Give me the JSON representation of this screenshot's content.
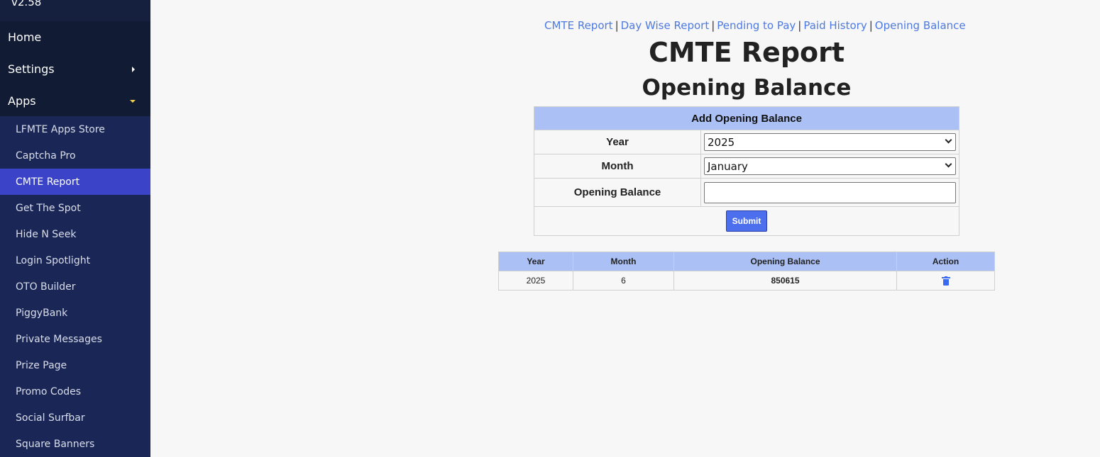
{
  "sidebar": {
    "version": "v2.58",
    "top_items": [
      {
        "label": "Home"
      },
      {
        "label": "Settings"
      },
      {
        "label": "Apps"
      }
    ],
    "app_items": [
      {
        "label": "LFMTE Apps Store"
      },
      {
        "label": "Captcha Pro"
      },
      {
        "label": "CMTE Report",
        "active": true
      },
      {
        "label": "Get The Spot"
      },
      {
        "label": "Hide N Seek"
      },
      {
        "label": "Login Spotlight"
      },
      {
        "label": "OTO Builder"
      },
      {
        "label": "PiggyBank"
      },
      {
        "label": "Private Messages"
      },
      {
        "label": "Prize Page"
      },
      {
        "label": "Promo Codes"
      },
      {
        "label": "Social Surfbar"
      },
      {
        "label": "Square Banners"
      }
    ]
  },
  "links": [
    "CMTE Report",
    "Day Wise Report",
    "Pending to Pay",
    "Paid History",
    "Opening Balance"
  ],
  "page": {
    "title": "CMTE Report",
    "subtitle": "Opening Balance"
  },
  "form": {
    "heading": "Add Opening Balance",
    "year_label": "Year",
    "year_value": "2025",
    "month_label": "Month",
    "month_value": "January",
    "balance_label": "Opening Balance",
    "balance_value": "",
    "submit_label": "Submit"
  },
  "table": {
    "headers": [
      "Year",
      "Month",
      "Opening Balance",
      "Action"
    ],
    "rows": [
      {
        "year": "2025",
        "month": "6",
        "balance": "850615",
        "action_icon": "trash-icon"
      }
    ]
  },
  "colors": {
    "sidebar_bg": "#15203f",
    "active_item": "#3b44c8",
    "table_header": "#abc0f5",
    "link": "#4d7ae0",
    "button": "#4c6fee"
  }
}
